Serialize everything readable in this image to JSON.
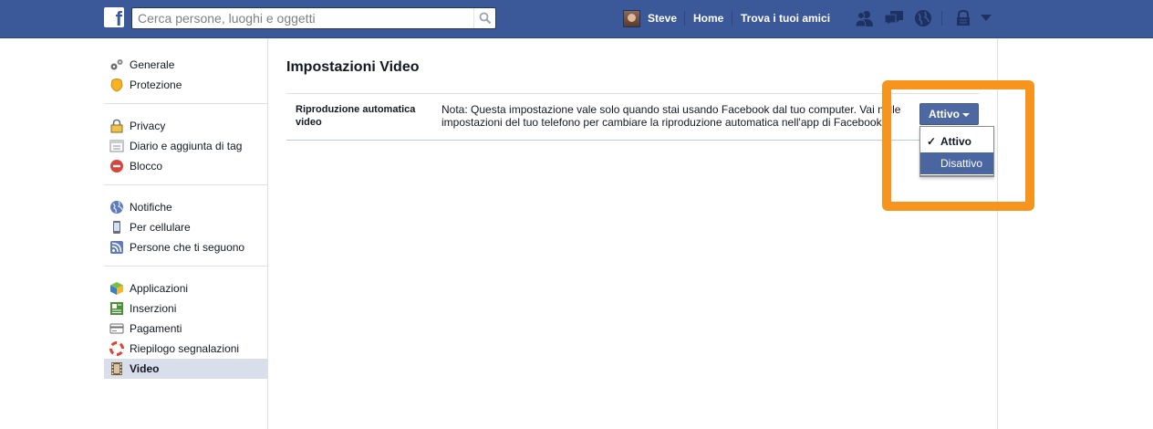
{
  "topbar": {
    "logo_letter": "f",
    "search_placeholder": "Cerca persone, luoghi e oggetti",
    "user_name": "Steve",
    "home_label": "Home",
    "find_friends_label": "Trova i tuoi amici",
    "icons": [
      "friend-requests-icon",
      "messages-icon",
      "notifications-icon",
      "privacy-shortcuts-icon",
      "account-menu-icon"
    ],
    "color": "#3b5998"
  },
  "sidebar": {
    "groups": [
      {
        "items": [
          {
            "label": "Generale",
            "icon": "gears-icon"
          },
          {
            "label": "Protezione",
            "icon": "badge-icon"
          }
        ]
      },
      {
        "items": [
          {
            "label": "Privacy",
            "icon": "lock-icon"
          },
          {
            "label": "Diario e aggiunta di tag",
            "icon": "timeline-icon"
          },
          {
            "label": "Blocco",
            "icon": "block-icon"
          }
        ]
      },
      {
        "items": [
          {
            "label": "Notifiche",
            "icon": "globe-icon"
          },
          {
            "label": "Per cellulare",
            "icon": "mobile-icon"
          },
          {
            "label": "Persone che ti seguono",
            "icon": "rss-icon"
          }
        ]
      },
      {
        "items": [
          {
            "label": "Applicazioni",
            "icon": "apps-cube-icon"
          },
          {
            "label": "Inserzioni",
            "icon": "ads-icon"
          },
          {
            "label": "Pagamenti",
            "icon": "credit-card-icon"
          },
          {
            "label": "Riepilogo segnalazioni",
            "icon": "lifebuoy-icon"
          },
          {
            "label": "Video",
            "icon": "film-icon",
            "active": true
          }
        ]
      }
    ]
  },
  "main": {
    "title": "Impostazioni Video",
    "setting": {
      "label": "Riproduzione automatica video",
      "description": "Nota: Questa impostazione vale solo quando stai usando Facebook dal tuo computer. Vai nelle impostazioni del tuo telefono per cambiare la riproduzione automatica nell'app di Facebook."
    },
    "dropdown": {
      "selected": "Attivo",
      "options": [
        {
          "label": "Attivo",
          "checked": true
        },
        {
          "label": "Disattivo",
          "hovered": true
        }
      ]
    }
  },
  "annotation": {
    "highlight_color": "#f7941d"
  }
}
